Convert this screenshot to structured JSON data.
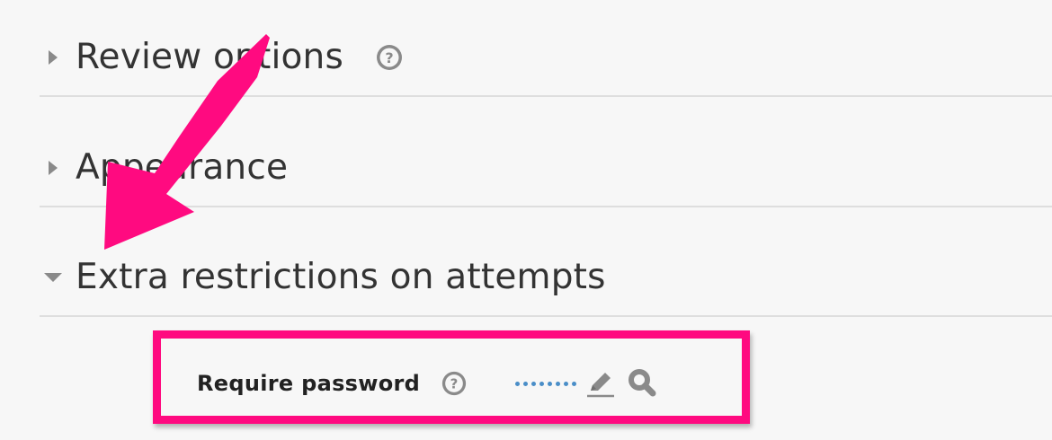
{
  "sections": [
    {
      "title": "Review options",
      "expanded": false,
      "has_help": true
    },
    {
      "title": "Appearance",
      "expanded": false,
      "has_help": false
    },
    {
      "title": "Extra restrictions on attempts",
      "expanded": true,
      "has_help": false
    }
  ],
  "password_field": {
    "label": "Require password",
    "masked_value": "••••••••",
    "icons": [
      "question-circle-icon",
      "pencil-icon",
      "magnifier-icon"
    ]
  },
  "annotation": {
    "color": "#ff0a80",
    "arrow_points_to": "Extra restrictions on attempts",
    "highlight_target": "Require password"
  },
  "colors": {
    "text": "#333333",
    "icon_gray": "#8a8a8a",
    "divider": "#dedede",
    "dots": "#4a8ec8",
    "annotation": "#ff0a80"
  }
}
